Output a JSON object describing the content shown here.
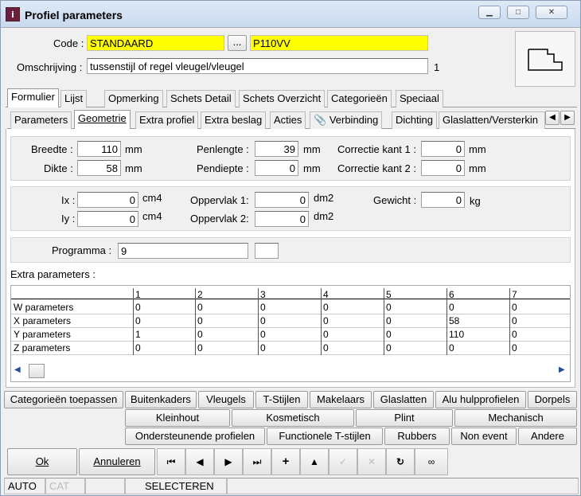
{
  "window": {
    "title": "Profiel parameters",
    "icon": "app-icon"
  },
  "header": {
    "code_label": "Code :",
    "code_value": "STANDAARD",
    "browse_label": "...",
    "code2_value": "P110VV",
    "desc_label": "Omschrijving :",
    "desc_value": "tussenstijl of regel vleugel/vleugel",
    "desc_count": "1"
  },
  "tabs_top": [
    "Formulier",
    "Lijst",
    "Opmerking",
    "Schets Detail",
    "Schets Overzicht",
    "Categorieën",
    "Speciaal"
  ],
  "tabs_sub": [
    "Parameters",
    "Geometrie",
    "Extra profiel",
    "Extra beslag",
    "Acties",
    "Verbinding",
    "Dichting",
    "Glaslatten/Versterkin"
  ],
  "geom": {
    "breedte_label": "Breedte :",
    "breedte": "110",
    "dikte_label": "Dikte :",
    "dikte": "58",
    "penlengte_label": "Penlengte :",
    "penlengte": "39",
    "pendiepte_label": "Pendiepte :",
    "pendiepte": "0",
    "corr1_label": "Correctie kant 1 :",
    "corr1": "0",
    "corr2_label": "Correctie kant 2 :",
    "corr2": "0",
    "mm": "mm"
  },
  "props": {
    "ix_label": "Ix :",
    "ix": "0",
    "iy_label": "Iy :",
    "iy": "0",
    "cm4": "cm4",
    "opp1_label": "Oppervlak 1:",
    "opp1": "0",
    "opp2_label": "Oppervlak 2:",
    "opp2": "0",
    "dm2": "dm2",
    "gewicht_label": "Gewicht :",
    "gewicht": "0",
    "kg": "kg"
  },
  "programma": {
    "label": "Programma :",
    "value": "9",
    "extra": ""
  },
  "extra": {
    "label": "Extra parameters :",
    "columns": [
      "1",
      "2",
      "3",
      "4",
      "5",
      "6",
      "7"
    ],
    "rows": [
      {
        "name": "W parameters",
        "values": [
          "0",
          "0",
          "0",
          "0",
          "0",
          "0",
          "0"
        ]
      },
      {
        "name": "X parameters",
        "values": [
          "0",
          "0",
          "0",
          "0",
          "0",
          "58",
          "0"
        ]
      },
      {
        "name": "Y parameters",
        "values": [
          "1",
          "0",
          "0",
          "0",
          "0",
          "110",
          "0"
        ]
      },
      {
        "name": "Z parameters",
        "values": [
          "0",
          "0",
          "0",
          "0",
          "0",
          "0",
          "0"
        ]
      }
    ]
  },
  "buttons_row1": [
    "Categorieën toepassen",
    "Buitenkaders",
    "Vleugels",
    "T-Stijlen",
    "Makelaars",
    "Glaslatten",
    "Alu hulpprofielen",
    "Dorpels"
  ],
  "buttons_row2": [
    "Kleinhout",
    "Kosmetisch",
    "Plint",
    "Mechanisch"
  ],
  "buttons_row3": [
    "Ondersteunende profielen",
    "Functionele T-stijlen",
    "Rubbers",
    "Non event",
    "Andere"
  ],
  "actions": {
    "ok": "Ok",
    "cancel": "Annuleren"
  },
  "status": {
    "mode": "AUTO",
    "cat": "CAT",
    "state": "SELECTEREN"
  }
}
